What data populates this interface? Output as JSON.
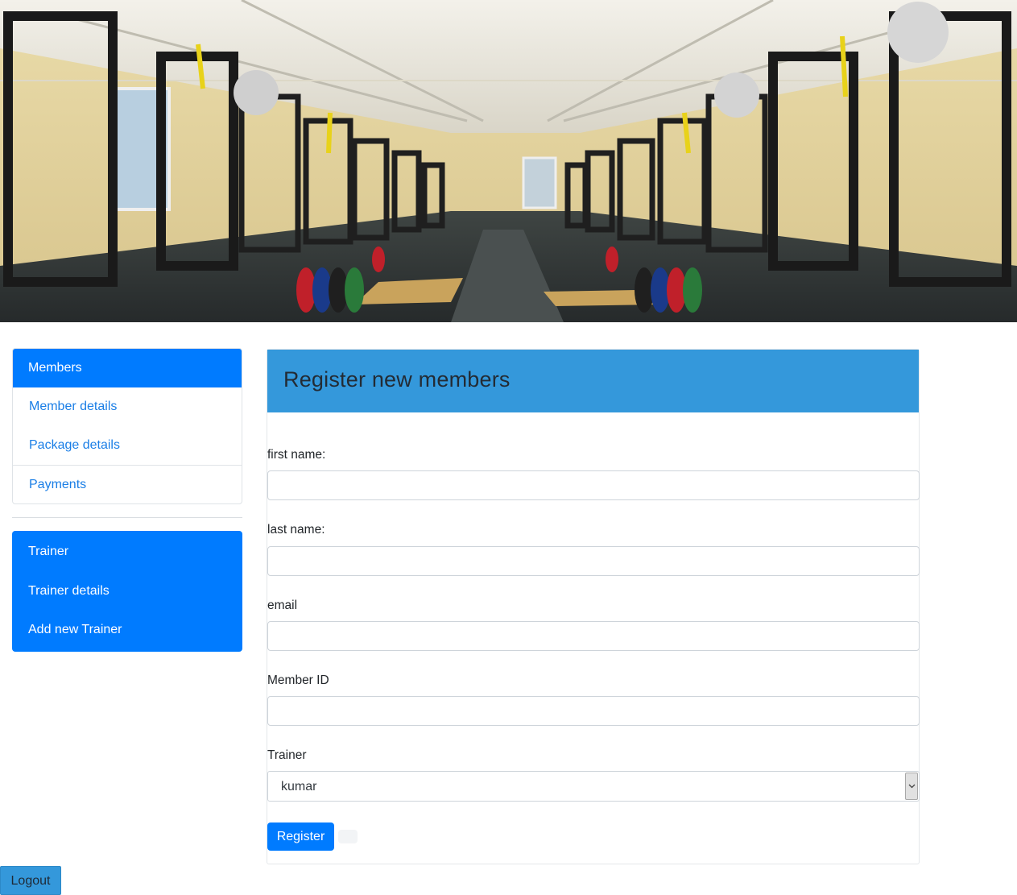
{
  "sidebar": {
    "members_header": "Members",
    "member_items": [
      "Member details",
      "Package details",
      "Payments"
    ],
    "trainer_header": "Trainer",
    "trainer_items": [
      "Trainer details",
      "Add new Trainer"
    ]
  },
  "form": {
    "title": "Register new members",
    "fields": [
      {
        "label": "first name:",
        "value": ""
      },
      {
        "label": "last name:",
        "value": ""
      },
      {
        "label": "email",
        "value": ""
      },
      {
        "label": "Member ID",
        "value": ""
      }
    ],
    "trainer_label": "Trainer",
    "trainer_selected": "kumar",
    "register_label": "Register"
  },
  "logout_label": "Logout",
  "colors": {
    "primary": "#007bff",
    "header_blue": "#3498db",
    "link": "#1a7ee6"
  }
}
